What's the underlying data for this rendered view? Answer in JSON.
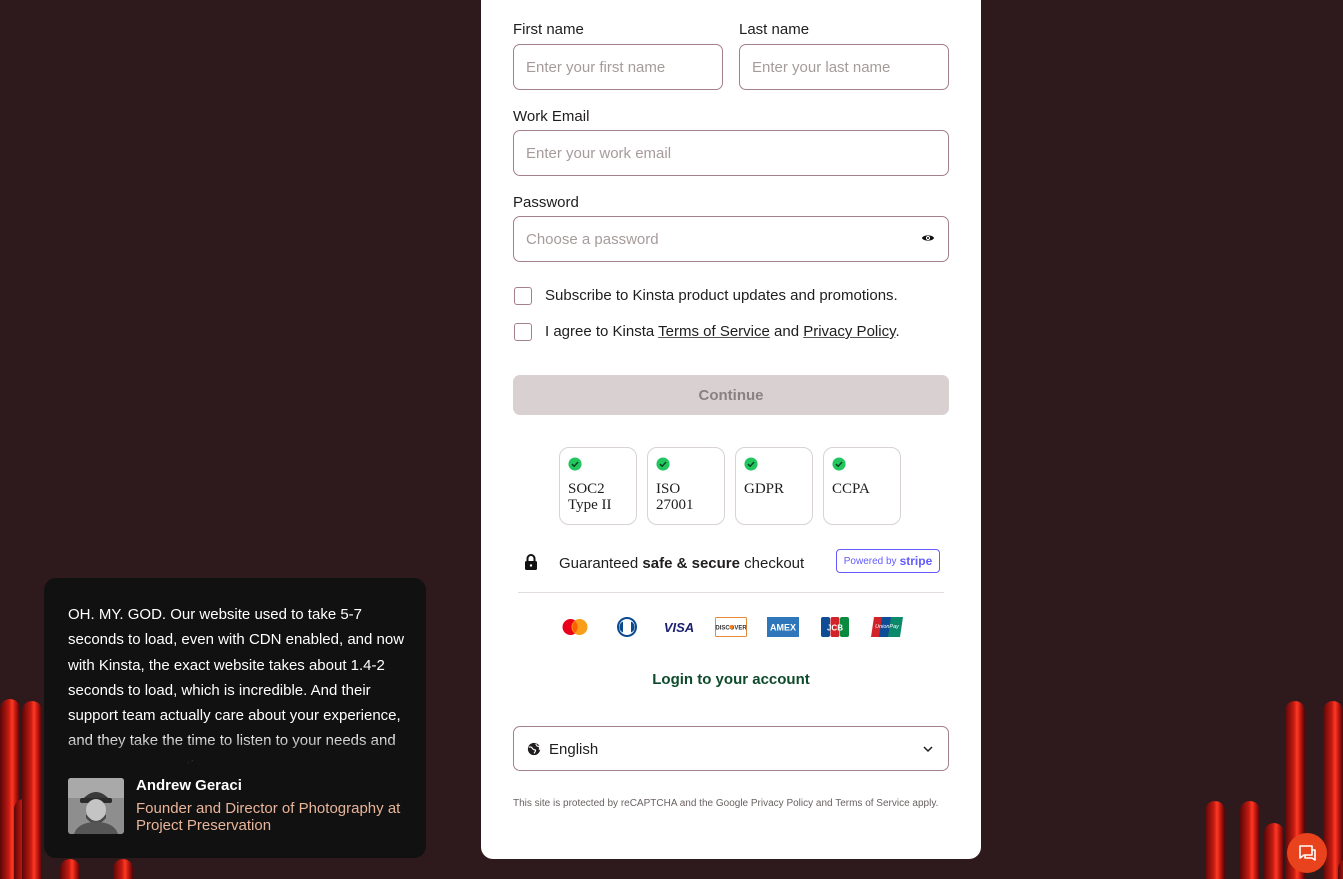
{
  "form": {
    "first_name_label": "First name",
    "first_name_placeholder": "Enter your first name",
    "first_name_value": "",
    "last_name_label": "Last name",
    "last_name_placeholder": "Enter your last name",
    "last_name_value": "",
    "email_label": "Work Email",
    "email_placeholder": "Enter your work email",
    "email_value": "",
    "password_label": "Password",
    "password_placeholder": "Choose a password",
    "password_value": "",
    "subscribe_label": "Subscribe to Kinsta product updates and promotions.",
    "agree_prefix": "I agree to Kinsta ",
    "terms_link": "Terms of Service",
    "agree_and": " and ",
    "privacy_link": "Privacy Policy",
    "agree_suffix": ".",
    "continue_label": "Continue"
  },
  "badges": [
    {
      "line1": "SOC2",
      "line2": "Type II"
    },
    {
      "line1": "ISO",
      "line2": "27001"
    },
    {
      "line1": "GDPR",
      "line2": ""
    },
    {
      "line1": "CCPA",
      "line2": ""
    }
  ],
  "checkout": {
    "prefix": "Guaranteed ",
    "emphasis": "safe & secure",
    "suffix": " checkout",
    "powered_by": "Powered by",
    "stripe": "stripe"
  },
  "payment_methods": [
    "mastercard-icon",
    "diners-club-icon",
    "visa-icon",
    "discover-icon",
    "amex-icon",
    "jcb-icon",
    "unionpay-icon"
  ],
  "login_link": "Login to your account",
  "language": {
    "selected": "English"
  },
  "recaptcha_text": "This site is protected by reCAPTCHA and the Google Privacy Policy and Terms of Service apply.",
  "testimonial": {
    "quote": "OH. MY. GOD. Our website used to take 5-7 seconds to load, even with CDN enabled, and now with Kinsta, the exact website takes about 1.4-2 seconds to load, which is incredible. And their support team actually care about your experience, and they take the time to listen to your needs and answer your questions.",
    "author": "Andrew Geraci",
    "role": "Founder and Director of Photography at Project Preservation"
  },
  "colors": {
    "background": "#2e1a1c",
    "accent_green": "#0e4a2c",
    "check_green": "#22c55e",
    "stripe": "#635bff",
    "chat_button": "#e8431c"
  }
}
